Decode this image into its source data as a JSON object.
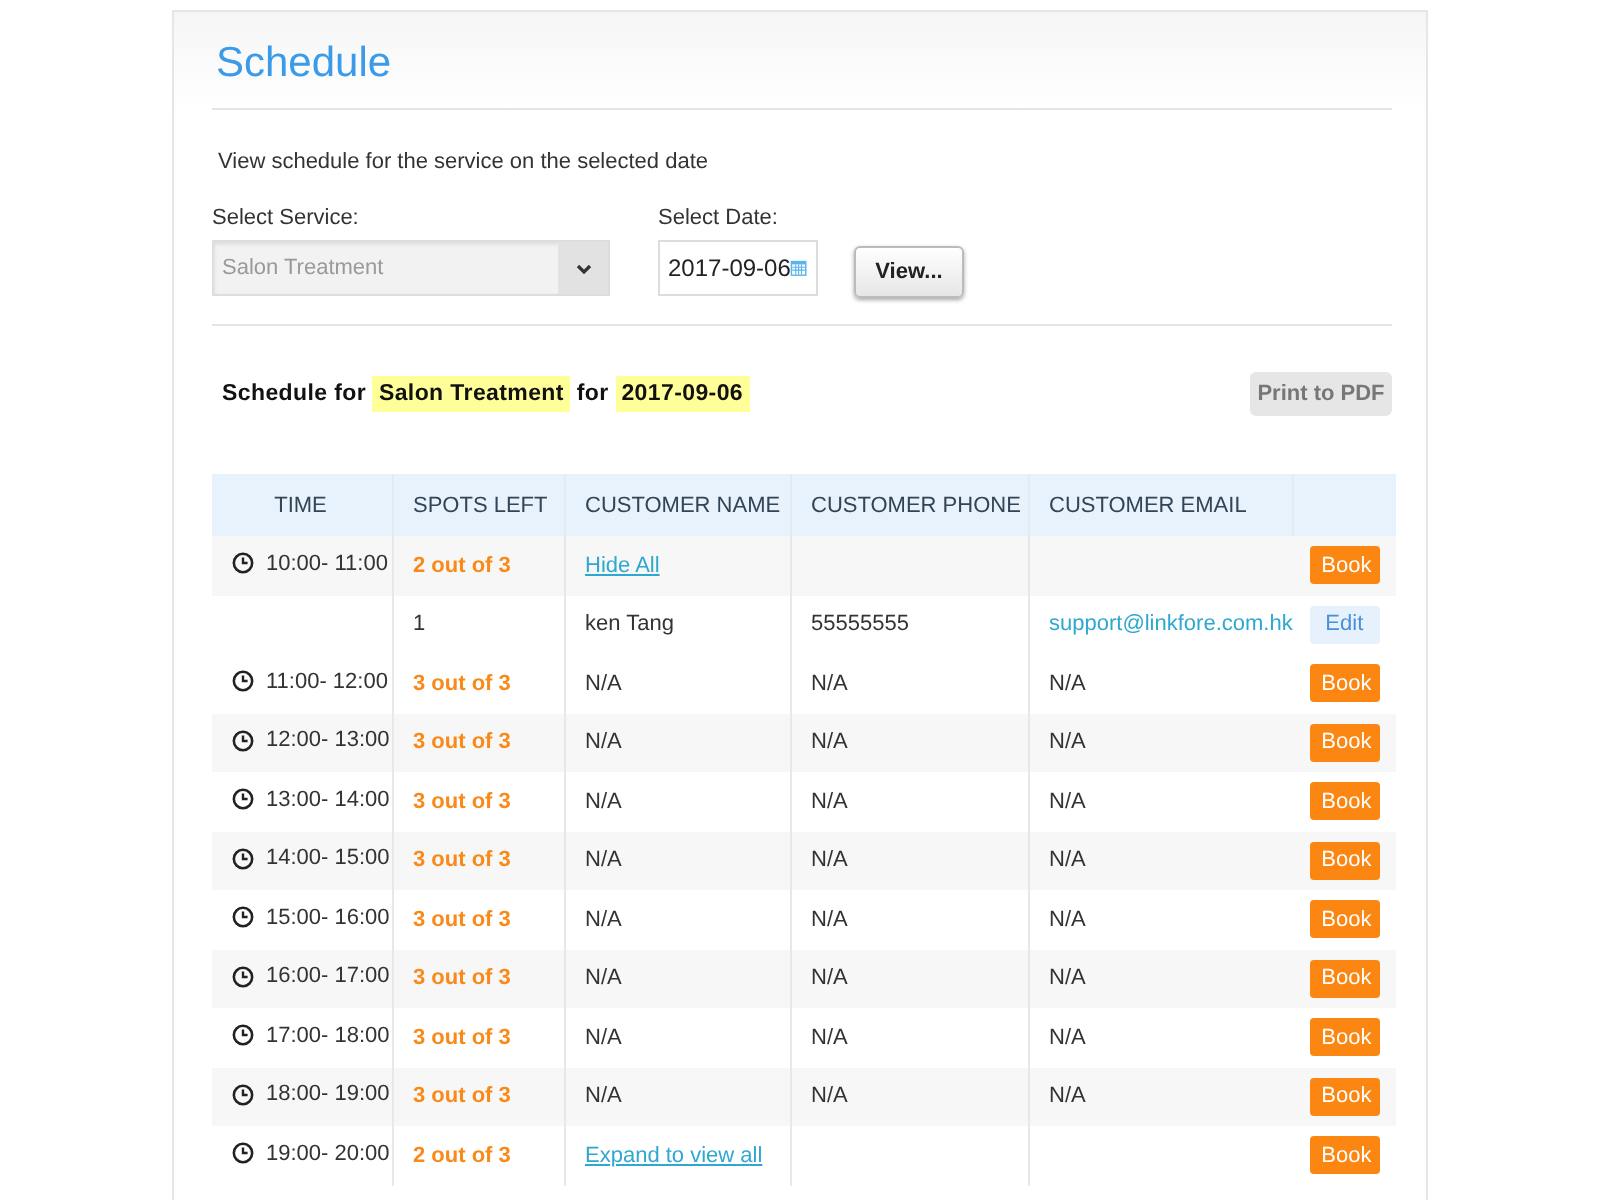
{
  "title": "Schedule",
  "intro": "View schedule for the service on the selected date",
  "service": {
    "label": "Select Service:",
    "value": "Salon Treatment"
  },
  "date": {
    "label": "Select Date:",
    "value": "2017-09-06"
  },
  "view_button": "View...",
  "heading": {
    "prefix": "Schedule for",
    "service": "Salon Treatment",
    "joiner": "for",
    "date": "2017-09-06"
  },
  "print_button": "Print to PDF",
  "table": {
    "columns": [
      "TIME",
      "SPOTS LEFT",
      "CUSTOMER NAME",
      "CUSTOMER PHONE",
      "CUSTOMER EMAIL"
    ],
    "rows": [
      {
        "kind": "group",
        "time": "10:00- 11:00",
        "spots": "2 out of 3",
        "link": "Hide All",
        "action": "Book"
      },
      {
        "kind": "booking",
        "spots": "1",
        "name": "ken Tang",
        "phone": "55555555",
        "email": "support@linkfore.com.hk",
        "action": "Edit"
      },
      {
        "kind": "slot",
        "time": "11:00- 12:00",
        "spots": "3 out of 3",
        "name": "N/A",
        "phone": "N/A",
        "email": "N/A",
        "action": "Book"
      },
      {
        "kind": "slot",
        "time": "12:00- 13:00",
        "spots": "3 out of 3",
        "name": "N/A",
        "phone": "N/A",
        "email": "N/A",
        "action": "Book"
      },
      {
        "kind": "slot",
        "time": "13:00- 14:00",
        "spots": "3 out of 3",
        "name": "N/A",
        "phone": "N/A",
        "email": "N/A",
        "action": "Book"
      },
      {
        "kind": "slot",
        "time": "14:00- 15:00",
        "spots": "3 out of 3",
        "name": "N/A",
        "phone": "N/A",
        "email": "N/A",
        "action": "Book"
      },
      {
        "kind": "slot",
        "time": "15:00- 16:00",
        "spots": "3 out of 3",
        "name": "N/A",
        "phone": "N/A",
        "email": "N/A",
        "action": "Book"
      },
      {
        "kind": "slot",
        "time": "16:00- 17:00",
        "spots": "3 out of 3",
        "name": "N/A",
        "phone": "N/A",
        "email": "N/A",
        "action": "Book"
      },
      {
        "kind": "slot",
        "time": "17:00- 18:00",
        "spots": "3 out of 3",
        "name": "N/A",
        "phone": "N/A",
        "email": "N/A",
        "action": "Book"
      },
      {
        "kind": "slot",
        "time": "18:00- 19:00",
        "spots": "3 out of 3",
        "name": "N/A",
        "phone": "N/A",
        "email": "N/A",
        "action": "Book"
      },
      {
        "kind": "group",
        "time": "19:00- 20:00",
        "spots": "2 out of 3",
        "link": "Expand to view all",
        "action": "Book"
      }
    ]
  }
}
